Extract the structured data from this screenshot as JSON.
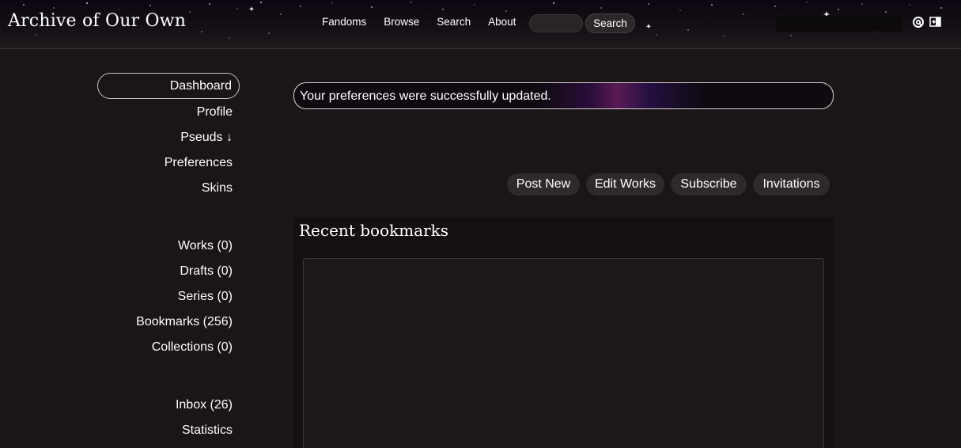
{
  "header": {
    "site_title": "Archive of Our Own",
    "nav": [
      "Fandoms",
      "Browse",
      "Search",
      "About"
    ],
    "search_placeholder": "",
    "search_button": "Search",
    "icons": [
      "at-sign-icon",
      "logout-icon"
    ]
  },
  "sidebar": {
    "primary": [
      "Dashboard",
      "Profile",
      "Pseuds ↓",
      "Preferences",
      "Skins"
    ],
    "works": [
      "Works (0)",
      "Drafts (0)",
      "Series (0)",
      "Bookmarks (256)",
      "Collections (0)"
    ],
    "other": [
      "Inbox (26)",
      "Statistics"
    ]
  },
  "main": {
    "notice": "Your preferences were successfully updated.",
    "actions": [
      "Post New",
      "Edit Works",
      "Subscribe",
      "Invitations"
    ],
    "recent_bookmarks_title": "Recent bookmarks"
  },
  "colors": {
    "background": "#1a1516",
    "header_bg": "#0b0710",
    "button_bg": "#2f292b",
    "text": "#ffffff",
    "notice_border": "#d8d0d3"
  }
}
